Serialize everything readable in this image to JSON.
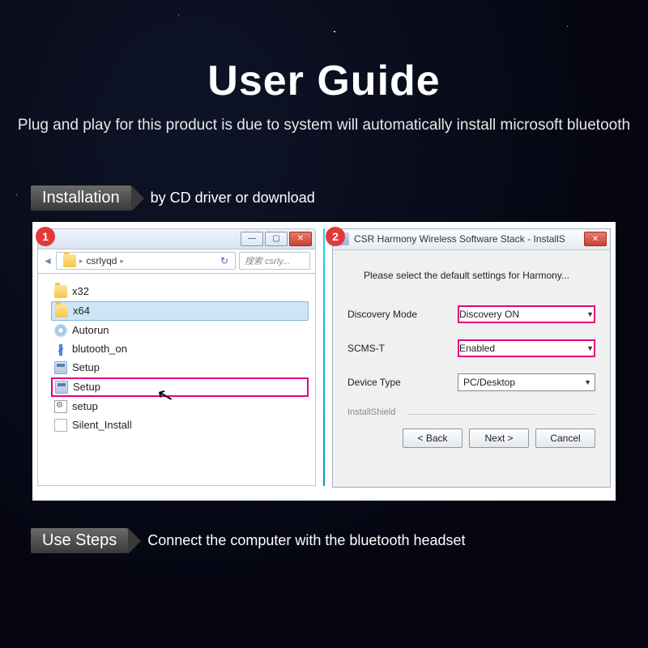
{
  "header": {
    "title": "User Guide",
    "subtitle": "Plug and play for this product is due to system will automatically install microsoft bluetooth"
  },
  "section1": {
    "tag": "Installation",
    "text": "by CD driver or download"
  },
  "explorer": {
    "badge": "1",
    "minimize": "—",
    "maximize": "▢",
    "close": "✕",
    "nav_back": "◄",
    "crumb_folder": "csrlyqd",
    "crumb_sep": "▸",
    "refresh": "↻",
    "search_placeholder": "搜索 csrly...",
    "files": [
      {
        "icon": "folder",
        "name": "x32"
      },
      {
        "icon": "folder",
        "name": "x64"
      },
      {
        "icon": "disc",
        "name": "Autorun"
      },
      {
        "icon": "bt",
        "name": "blutooth_on"
      },
      {
        "icon": "setup",
        "name": "Setup"
      },
      {
        "icon": "setup",
        "name": "Setup"
      },
      {
        "icon": "cfg",
        "name": "setup"
      },
      {
        "icon": "doc",
        "name": "Silent_Install"
      }
    ]
  },
  "installer": {
    "badge": "2",
    "title": "CSR Harmony Wireless Software Stack - InstallS",
    "close": "✕",
    "intro": "Please select the default settings for Harmony...",
    "rows": [
      {
        "label": "Discovery Mode",
        "value": "Discovery ON",
        "hl": true
      },
      {
        "label": "SCMS-T",
        "value": "Enabled",
        "hl": true
      },
      {
        "label": "Device Type",
        "value": "PC/Desktop",
        "hl": false
      }
    ],
    "legend": "InstallShield",
    "buttons": {
      "back": "< Back",
      "next": "Next >",
      "cancel": "Cancel"
    }
  },
  "section2": {
    "tag": "Use Steps",
    "text": "Connect the computer with the bluetooth headset"
  },
  "icons": {
    "bt": "∦"
  }
}
